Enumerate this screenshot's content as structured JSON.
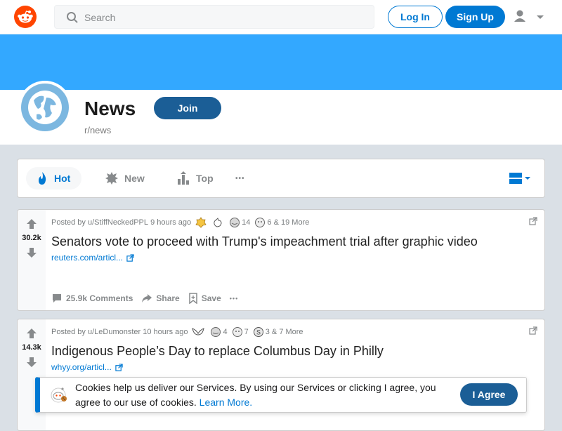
{
  "header": {
    "logo_icon": "reddit-logo",
    "search_placeholder": "Search",
    "login_label": "Log In",
    "signup_label": "Sign Up",
    "user_icon": "user-icon"
  },
  "subreddit": {
    "title": "News",
    "name": "r/news",
    "join_label": "Join",
    "avatar_icon": "globe-icon",
    "banner_color": "#33a8ff"
  },
  "sort": {
    "items": [
      {
        "label": "Hot",
        "icon": "flame-icon",
        "active": true
      },
      {
        "label": "New",
        "icon": "burst-icon"
      },
      {
        "label": "Top",
        "icon": "bar-chart-icon"
      }
    ],
    "more": "•••",
    "view_icon": "card-view-icon"
  },
  "posts": [
    {
      "votes": "30.2k",
      "meta_prefix": "Posted by",
      "author": "u/StiffNeckedPPL",
      "time": "9 hours ago",
      "awards": [
        {
          "icon": "platinum-award-icon",
          "count": ""
        },
        {
          "icon": "hand-award-icon",
          "count": ""
        },
        {
          "icon": "silver-award-icon",
          "count": "14"
        },
        {
          "icon": "face-award-icon",
          "count": "6"
        }
      ],
      "more_awards": "& 19 More",
      "title": "Senators vote to proceed with Trump's impeachment trial after graphic video",
      "link": "reuters.com/articl...",
      "comments": "25.9k Comments",
      "share": "Share",
      "save": "Save",
      "more": "•••"
    },
    {
      "votes": "14.3k",
      "meta_prefix": "Posted by",
      "author": "u/LeDumonster",
      "time": "10 hours ago",
      "awards": [
        {
          "icon": "wings-award-icon",
          "count": ""
        },
        {
          "icon": "silver-award-icon",
          "count": "4"
        },
        {
          "icon": "face-award-icon",
          "count": "7"
        },
        {
          "icon": "coin-award-icon",
          "count": "3"
        }
      ],
      "more_awards": "& 7 More",
      "title": "Indigenous People’s Day to replace Columbus Day in Philly",
      "link": "whyy.org/articl...",
      "comments": "",
      "share": "",
      "save": "",
      "more": ""
    }
  ],
  "cookie": {
    "text": "Cookies help us deliver our Services. By using our Services or clicking I agree, you agree to our use of cookies.",
    "link": "Learn More.",
    "agree_label": "I Agree"
  },
  "colors": {
    "accent": "#0079d3",
    "brand": "#ff4500",
    "join": "#1b5e96",
    "background": "#dae0e6"
  }
}
